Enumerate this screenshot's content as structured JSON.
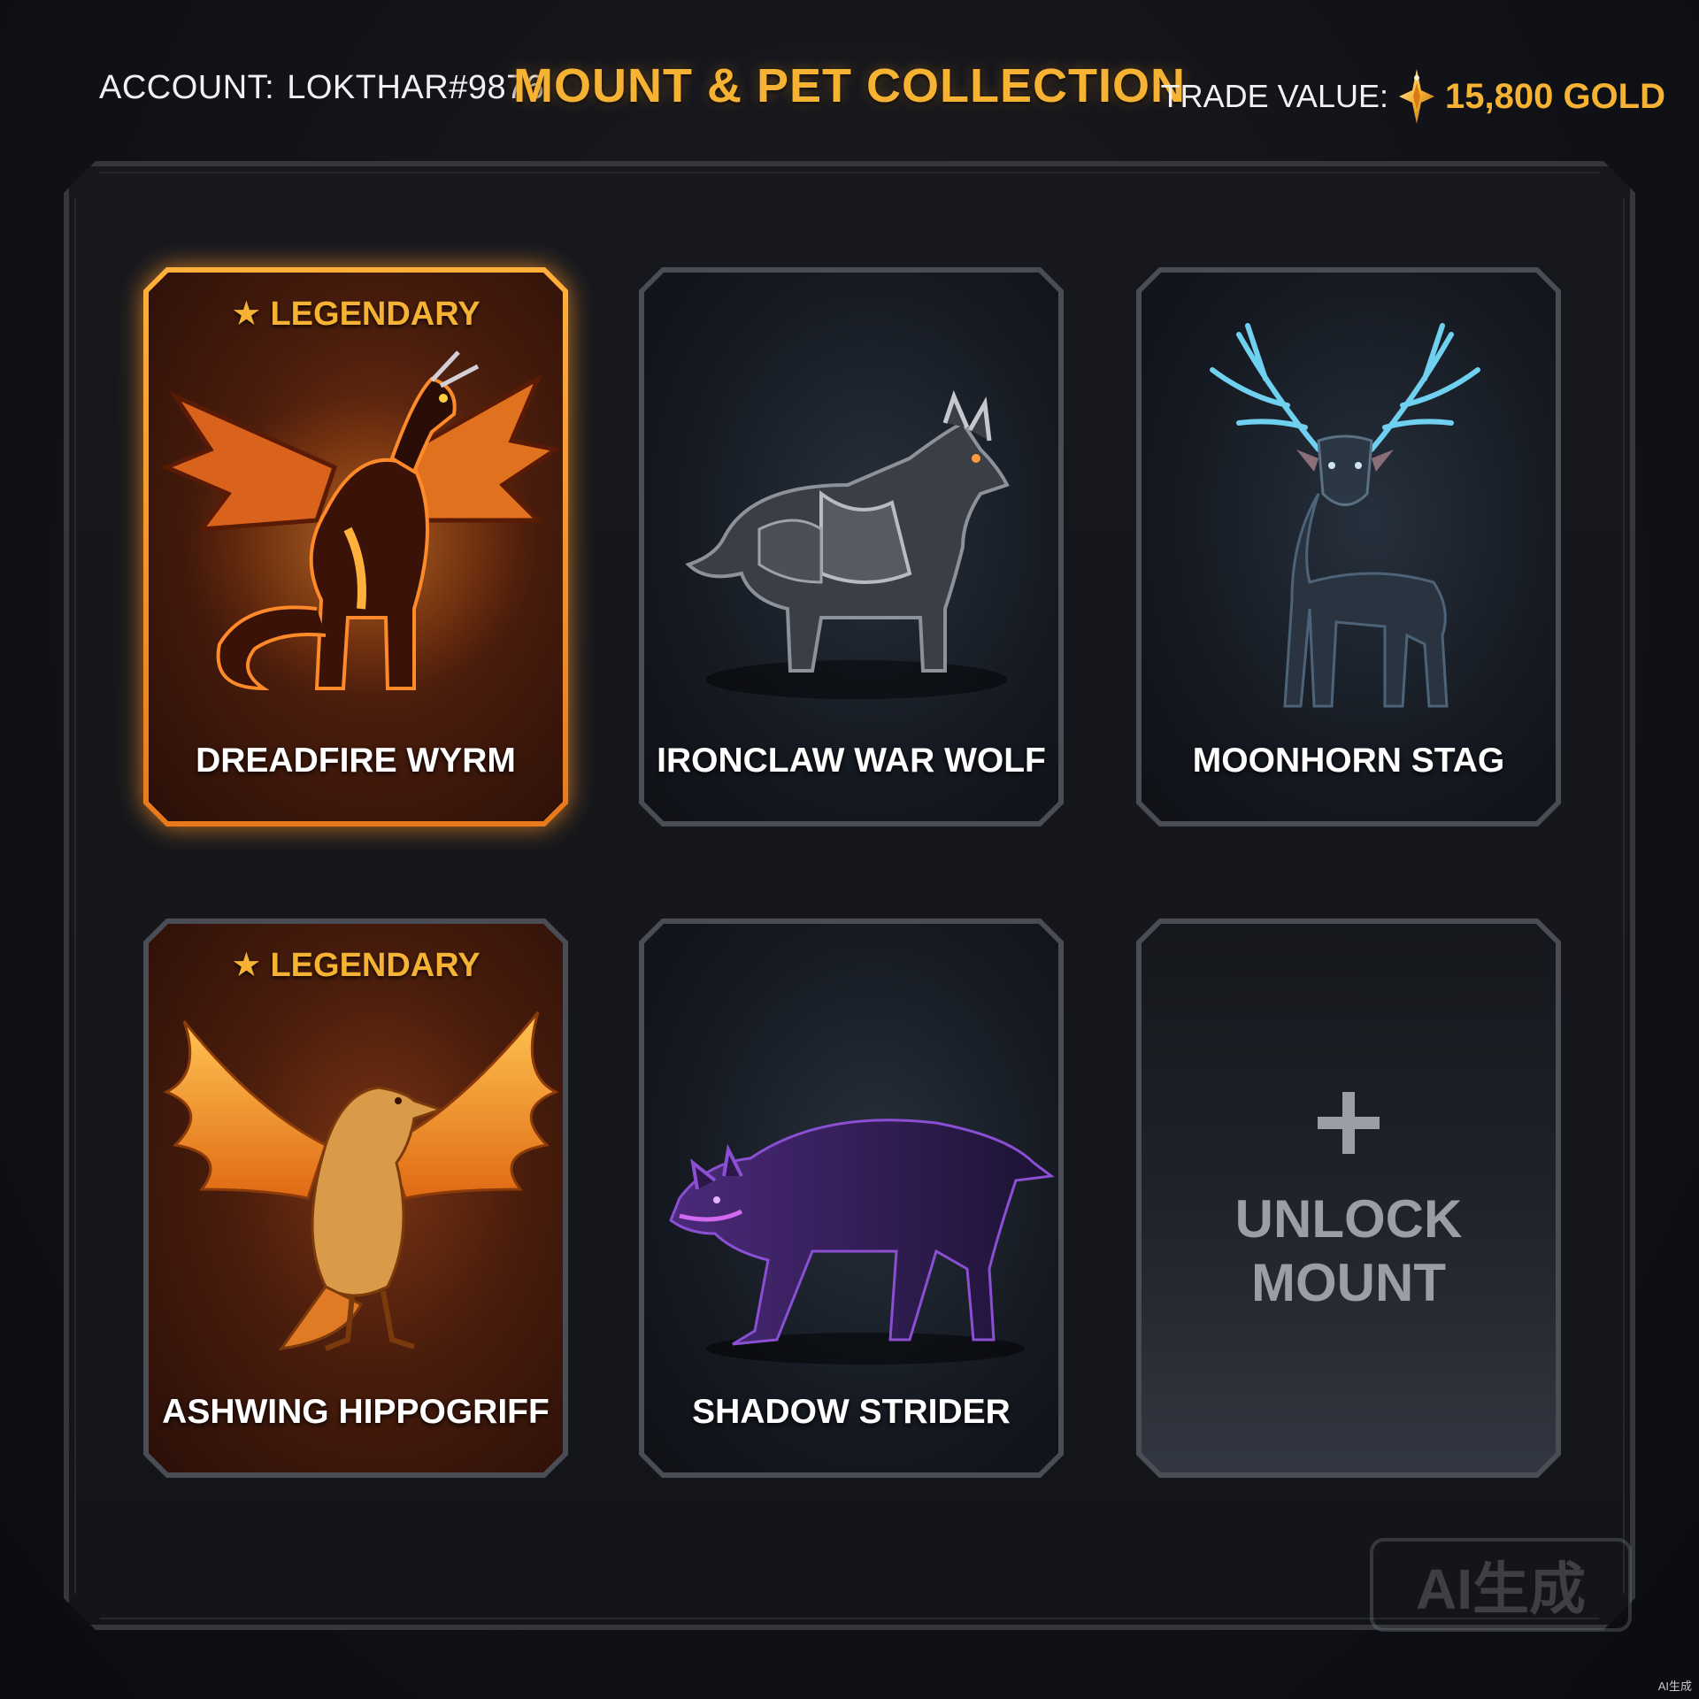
{
  "header": {
    "account_label": "ACCOUNT:",
    "account_name": "LOKTHAR#9876",
    "title": "MOUNT & PET COLLECTION",
    "trade_label": "TRADE VALUE:",
    "gold_amount": "15,800 GOLD",
    "gold_icon": "gold-diamond-icon"
  },
  "colors": {
    "accent_gold": "#f6b233",
    "legendary_border": "#ffb03a",
    "card_border": "#4a4d55",
    "background": "#121318"
  },
  "cards": [
    {
      "name": "DREADFIRE WYRM",
      "badge": "LEGENDARY",
      "rarity": "legendary",
      "selected": true,
      "art": "dragon-icon"
    },
    {
      "name": "IRONCLAW WAR WOLF",
      "badge": "",
      "rarity": "normal",
      "selected": false,
      "art": "armored-wolf-icon"
    },
    {
      "name": "MOONHORN STAG",
      "badge": "",
      "rarity": "normal",
      "selected": false,
      "art": "stag-icon"
    },
    {
      "name": "ASHWING HIPPOGRIFF",
      "badge": "LEGENDARY",
      "rarity": "legendary",
      "selected": false,
      "art": "hippogriff-icon"
    },
    {
      "name": "SHADOW STRIDER",
      "badge": "",
      "rarity": "normal",
      "selected": false,
      "art": "shadow-wolf-icon"
    }
  ],
  "unlock_card": {
    "line1": "UNLOCK",
    "line2": "MOUNT",
    "icon": "plus-icon"
  },
  "watermark": {
    "text": "AI生成",
    "corner_text": "AI生成"
  }
}
